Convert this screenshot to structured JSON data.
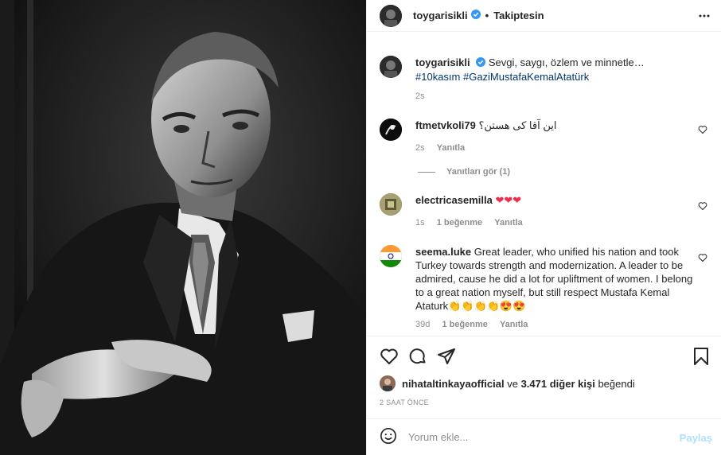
{
  "header": {
    "username": "toygarisikli",
    "separator": "•",
    "follow_label": "Takiptesin"
  },
  "caption": {
    "username": "toygarisikli",
    "text": "Sevgi, saygı, özlem ve minnetle…",
    "hashtags": "#10kasım #GaziMustafaKemalAtatürk",
    "time": "2s"
  },
  "comments": [
    {
      "username": "ftmetvkoli79",
      "text": "این آقا کی هستن؟",
      "time": "2s",
      "likes": "",
      "reply": "Yanıtla"
    },
    {
      "username": "electricasemilla",
      "text": "❤❤❤",
      "time": "1s",
      "likes": "1 beğenme",
      "reply": "Yanıtla"
    },
    {
      "username": "seema.luke",
      "text": "Great leader, who unified his nation and took Turkey towards strength and modernization. A leader to be admired, cause he did a lot for upliftment of women. I belong to a great nation myself, but still respect Mustafa Kemal Ataturk👏👏👏👏😍😍",
      "time": "39d",
      "likes": "1 beğenme",
      "reply": "Yanıtla"
    }
  ],
  "view_replies": "Yanıtları gör (1)",
  "likes_bar": {
    "user": "nihataltinkayaofficial",
    "conj": "ve",
    "others": "3.471 diğer kişi",
    "suffix": "beğendi"
  },
  "post_time": "2 SAAT ÖNCE",
  "add_comment": {
    "placeholder": "Yorum ekle...",
    "post_label": "Paylaş"
  },
  "colors": {
    "link": "#00376b",
    "verified": "#3897f0",
    "muted": "#8e8e8e",
    "post_disabled": "#b2dffc"
  }
}
